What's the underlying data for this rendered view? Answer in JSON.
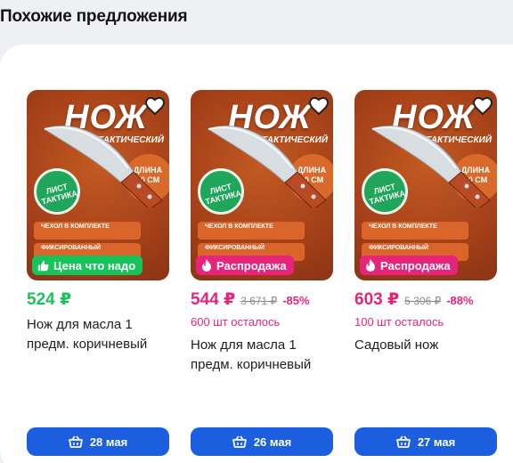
{
  "section": {
    "title": "Похожие предложения"
  },
  "image_text": {
    "title": "НОЖ",
    "subtitle": "ТАКТИЧЕСКИЙ",
    "length": "ДЛИНА 20 СМ",
    "seal": "ЛИСТ ТАКТИКА",
    "line1": "ЧЕХОЛ В КОМПЛЕКТЕ",
    "line2": "ФИКСИРОВАННЫЙ"
  },
  "products": [
    {
      "badge": {
        "label": "Цена что надо",
        "icon": "thumbs-up-icon",
        "color": "#17c45a"
      },
      "price": "524 ₽",
      "old_price": "",
      "discount": "",
      "stock": "",
      "name": "Нож для масла 1 предм. коричневый",
      "delivery": "28 мая"
    },
    {
      "badge": {
        "label": "Распродажа",
        "icon": "fire-icon",
        "color": "#e8247a"
      },
      "price": "544 ₽",
      "old_price": "3 671 ₽",
      "discount": "-85%",
      "stock": "600 шт осталось",
      "name": "Нож для масла 1 предм. коричневый",
      "delivery": "26 мая"
    },
    {
      "badge": {
        "label": "Распродажа",
        "icon": "fire-icon",
        "color": "#e8247a"
      },
      "price": "603 ₽",
      "old_price": "5 306 ₽",
      "discount": "-88%",
      "stock": "100 шт осталось",
      "name": "Садовый нож",
      "delivery": "27 мая"
    }
  ],
  "icons": {
    "favorite": "heart-icon",
    "delivery": "basket-icon"
  },
  "colors": {
    "green": "#17c45a",
    "pink": "#e8247a",
    "blue": "#1b5fe0"
  }
}
